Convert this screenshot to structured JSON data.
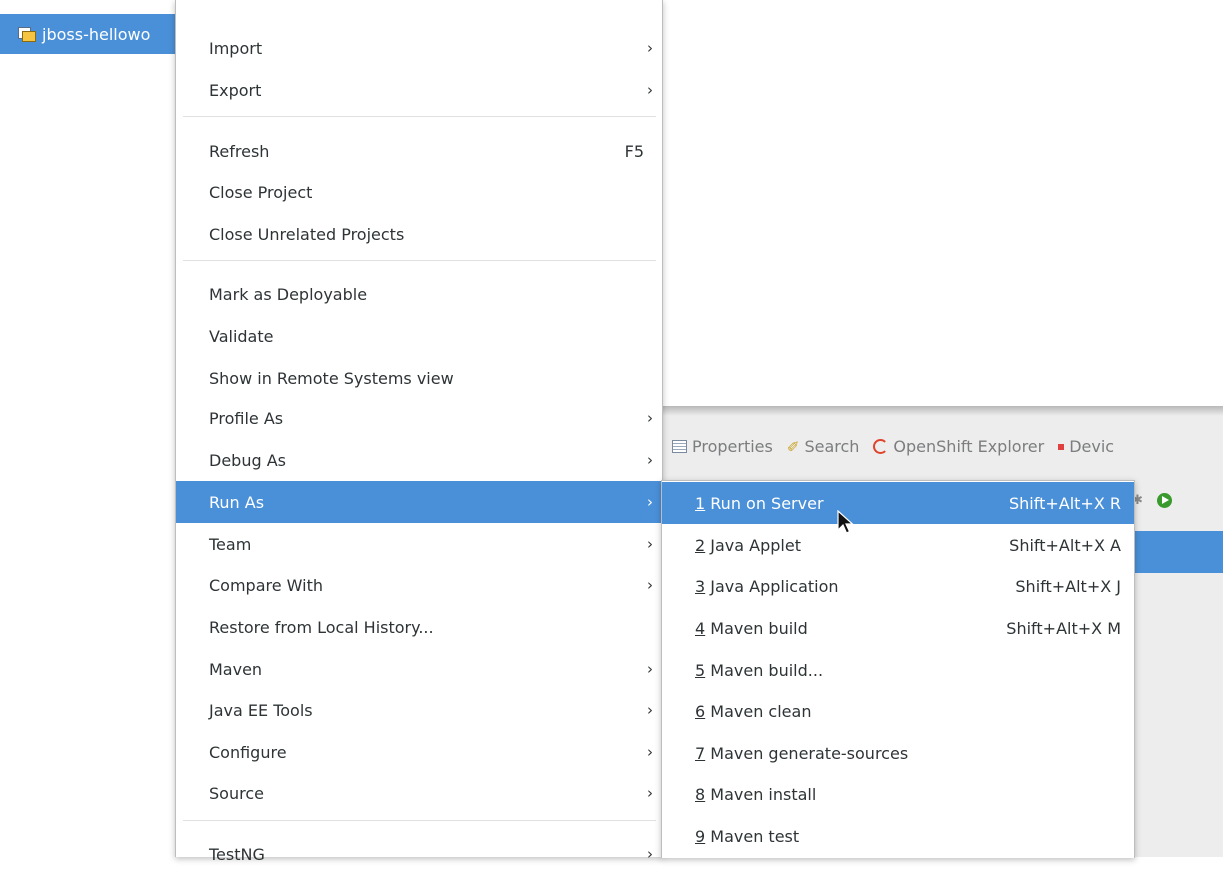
{
  "project_explorer": {
    "selected_project": "jboss-hellowo",
    "icon": "project-folder-icon"
  },
  "views": {
    "tabs": [
      {
        "label": "Properties",
        "icon": "properties-icon"
      },
      {
        "label": "Search",
        "icon": "search-icon"
      },
      {
        "label": "OpenShift Explorer",
        "icon": "openshift-icon"
      },
      {
        "label": "Devic",
        "icon": "devices-icon"
      }
    ],
    "toolbar_icons": [
      "debug-icon",
      "run-icon"
    ]
  },
  "context_menu": {
    "items": [
      {
        "label": "Import",
        "submenu": true
      },
      {
        "label": "Export",
        "submenu": true
      },
      {
        "label": "Refresh",
        "accelerator": "F5"
      },
      {
        "label": "Close Project"
      },
      {
        "label": "Close Unrelated Projects"
      },
      {
        "label": "Mark as Deployable"
      },
      {
        "label": "Validate"
      },
      {
        "label": "Show in Remote Systems view"
      },
      {
        "label": "Profile As",
        "submenu": true
      },
      {
        "label": "Debug As",
        "submenu": true
      },
      {
        "label": "Run As",
        "submenu": true,
        "active": true
      },
      {
        "label": "Team",
        "submenu": true
      },
      {
        "label": "Compare With",
        "submenu": true
      },
      {
        "label": "Restore from Local History..."
      },
      {
        "label": "Maven",
        "submenu": true
      },
      {
        "label": "Java EE Tools",
        "submenu": true
      },
      {
        "label": "Configure",
        "submenu": true
      },
      {
        "label": "Source",
        "submenu": true
      },
      {
        "label": "TestNG",
        "submenu": true
      }
    ],
    "arrow_glyph": "›"
  },
  "run_as_submenu": {
    "items": [
      {
        "mnemonic": "1",
        "label": " Run on Server",
        "accelerator": "Shift+Alt+X R"
      },
      {
        "mnemonic": "2",
        "label": " Java Applet",
        "accelerator": "Shift+Alt+X A"
      },
      {
        "mnemonic": "3",
        "label": " Java Application",
        "accelerator": "Shift+Alt+X J"
      },
      {
        "mnemonic": "4",
        "label": " Maven build",
        "accelerator": "Shift+Alt+X M"
      },
      {
        "mnemonic": "5",
        "label": " Maven build..."
      },
      {
        "mnemonic": "6",
        "label": " Maven clean"
      },
      {
        "mnemonic": "7",
        "label": " Maven generate-sources"
      },
      {
        "mnemonic": "8",
        "label": " Maven install"
      },
      {
        "mnemonic": "9",
        "label": " Maven test"
      }
    ]
  },
  "colors": {
    "selection": "#4a90d9",
    "menu_bg": "#ffffff",
    "text": "#2e3436"
  }
}
